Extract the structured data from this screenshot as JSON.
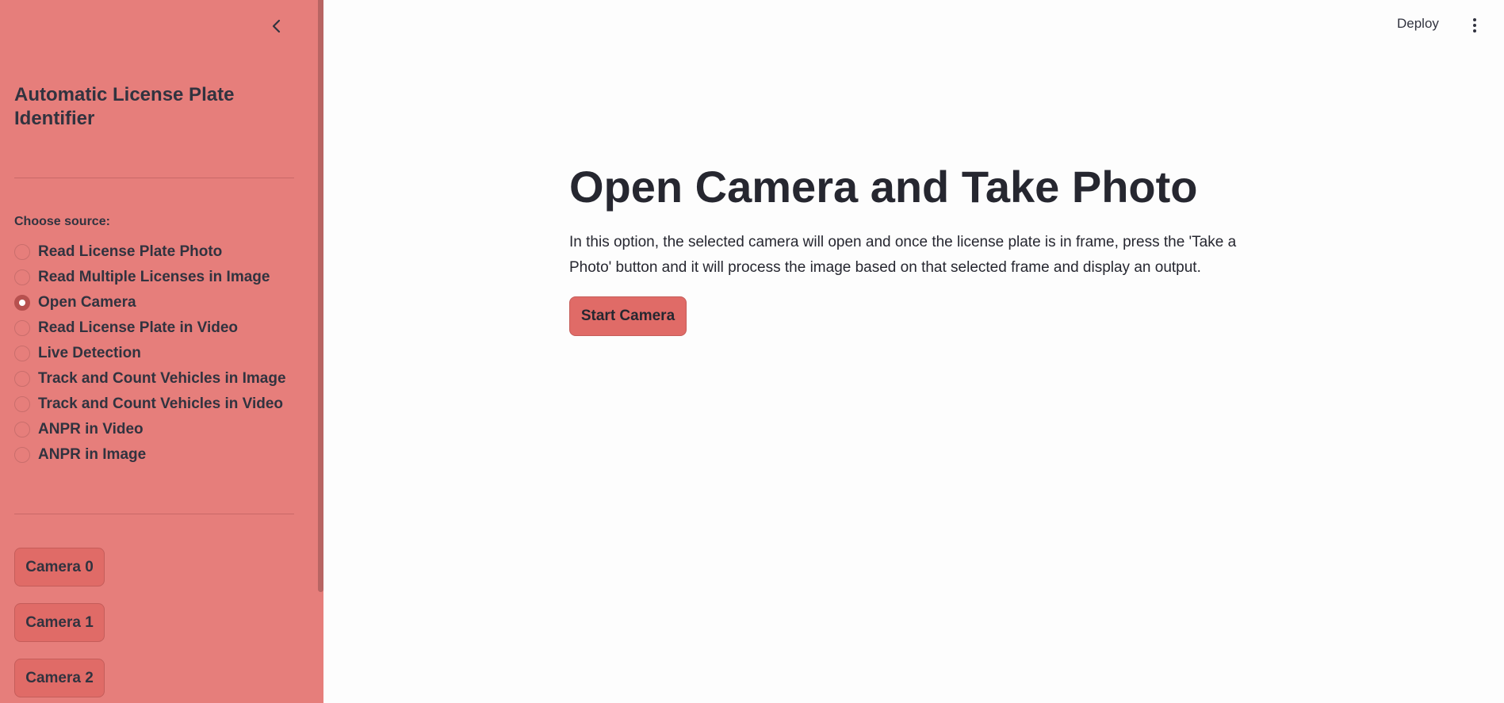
{
  "sidebar": {
    "collapse_icon": "chevron-left-icon",
    "app_title": "Automatic License Plate Identifier",
    "source_label": "Choose source:",
    "sources": [
      {
        "label": "Read License Plate Photo",
        "selected": false
      },
      {
        "label": "Read Multiple Licenses in Image",
        "selected": false
      },
      {
        "label": "Open Camera",
        "selected": true
      },
      {
        "label": "Read License Plate in Video",
        "selected": false
      },
      {
        "label": "Live Detection",
        "selected": false
      },
      {
        "label": "Track and Count Vehicles in Image",
        "selected": false
      },
      {
        "label": "Track and Count Vehicles in Video",
        "selected": false
      },
      {
        "label": "ANPR in Video",
        "selected": false
      },
      {
        "label": "ANPR in Image",
        "selected": false
      }
    ],
    "camera_buttons": [
      "Camera 0",
      "Camera 1",
      "Camera 2"
    ]
  },
  "header": {
    "deploy_label": "Deploy",
    "menu_icon": "kebab-menu-icon"
  },
  "main": {
    "title": "Open Camera and Take Photo",
    "description": "In this option, the selected camera will open and once the license plate is in frame, press the 'Take a Photo' button and it will process the image based on that selected frame and display an output.",
    "start_button": "Start Camera"
  },
  "colors": {
    "sidebar_bg": "#e67e7b",
    "button_bg": "#e06b67",
    "radio_selected": "#b7514f",
    "main_bg": "#fdfdfd"
  }
}
